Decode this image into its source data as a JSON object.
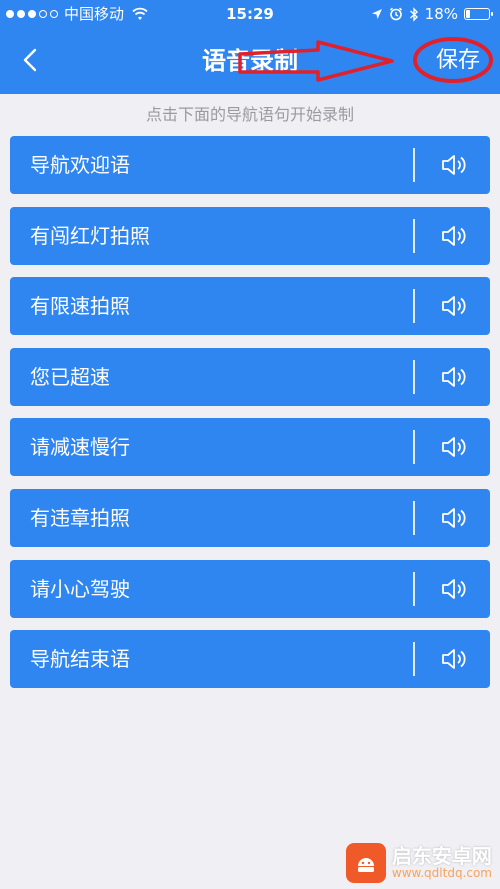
{
  "status_bar": {
    "carrier": "中国移动",
    "time": "15:29",
    "battery": "18%",
    "battery_level": 0.18
  },
  "nav": {
    "title": "语音录制",
    "save_label": "保存"
  },
  "hint": "点击下面的导航语句开始录制",
  "items": [
    {
      "label": "导航欢迎语"
    },
    {
      "label": "有闯红灯拍照"
    },
    {
      "label": "有限速拍照"
    },
    {
      "label": "您已超速"
    },
    {
      "label": "请减速慢行"
    },
    {
      "label": "有违章拍照"
    },
    {
      "label": "请小心驾驶"
    },
    {
      "label": "导航结束语"
    }
  ],
  "watermark": {
    "name": "启东安卓网",
    "url": "www.qdltdq.com"
  },
  "colors": {
    "primary": "#2f86f0",
    "background": "#efeff4",
    "hint_text": "#9a9aa0",
    "annotation": "#e0202a"
  },
  "icons": {
    "back": "chevron-left-icon",
    "speaker": "speaker-icon",
    "wifi": "wifi-icon",
    "location": "location-arrow-icon",
    "alarm": "alarm-icon",
    "bluetooth": "bluetooth-icon",
    "battery": "battery-icon"
  }
}
